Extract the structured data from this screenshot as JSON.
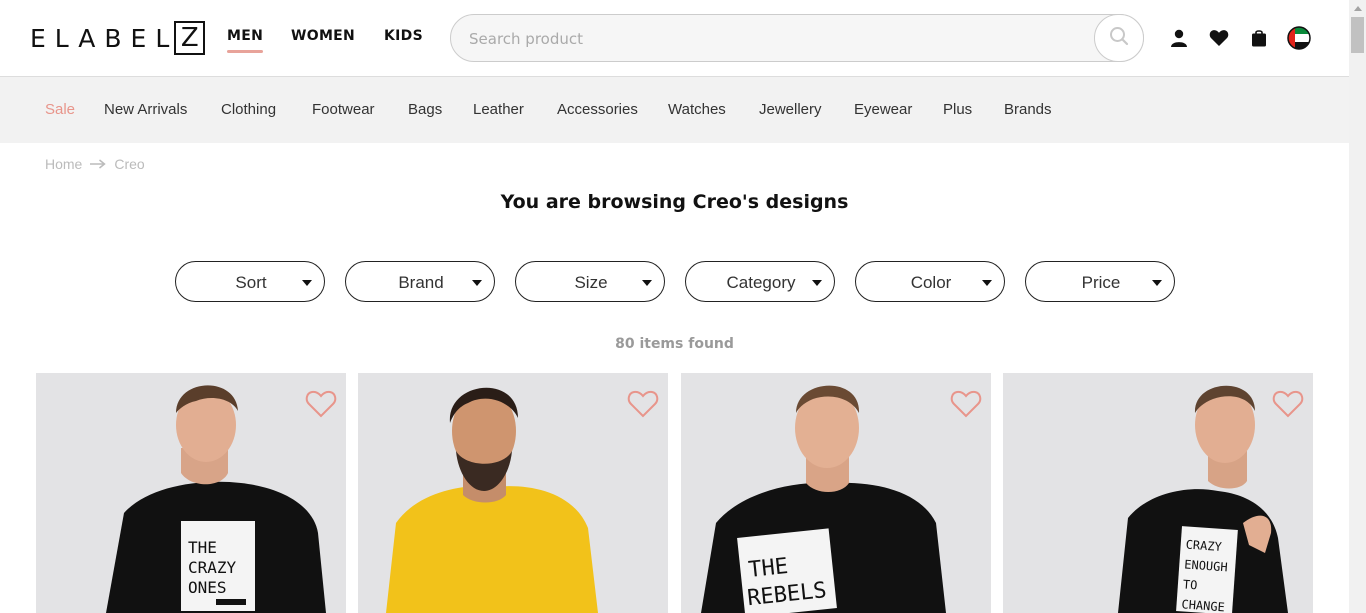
{
  "header": {
    "logo_letters": "ELABEL",
    "logo_box_letter": "Z",
    "genders": [
      {
        "label": "MEN",
        "active": true
      },
      {
        "label": "WOMEN",
        "active": false
      },
      {
        "label": "KIDS",
        "active": false
      }
    ],
    "search_placeholder": "Search product",
    "icons": [
      "search-icon",
      "user-icon",
      "heart-icon",
      "bag-icon",
      "uae-flag-icon"
    ]
  },
  "category_nav": [
    {
      "label": "Sale"
    },
    {
      "label": "New Arrivals"
    },
    {
      "label": "Clothing"
    },
    {
      "label": "Footwear"
    },
    {
      "label": "Bags"
    },
    {
      "label": "Leather"
    },
    {
      "label": "Accessories"
    },
    {
      "label": "Watches"
    },
    {
      "label": "Jewellery"
    },
    {
      "label": "Eyewear"
    },
    {
      "label": "Plus"
    },
    {
      "label": "Brands"
    }
  ],
  "breadcrumb": {
    "home": "Home",
    "current": "Creo"
  },
  "page_title": "You are browsing Creo's designs",
  "filters": [
    {
      "label": "Sort"
    },
    {
      "label": "Brand"
    },
    {
      "label": "Size"
    },
    {
      "label": "Category"
    },
    {
      "label": "Color"
    },
    {
      "label": "Price"
    }
  ],
  "items_found": "80 items found",
  "products": [
    {
      "shirt_color": "#111111",
      "print_lines": [
        "THE",
        "CRAZY",
        "ONES"
      ]
    },
    {
      "shirt_color": "#f2c21a",
      "print_lines": []
    },
    {
      "shirt_color": "#111111",
      "print_lines": [
        "THE",
        "REBELS"
      ]
    },
    {
      "shirt_color": "#111111",
      "print_lines": [
        "CRAZY",
        "ENOUGH",
        "TO",
        "CHANGE"
      ]
    }
  ],
  "colors": {
    "accent": "#e8958b",
    "nav_bg": "#f2f2f2",
    "card_bg": "#e3e3e5"
  }
}
